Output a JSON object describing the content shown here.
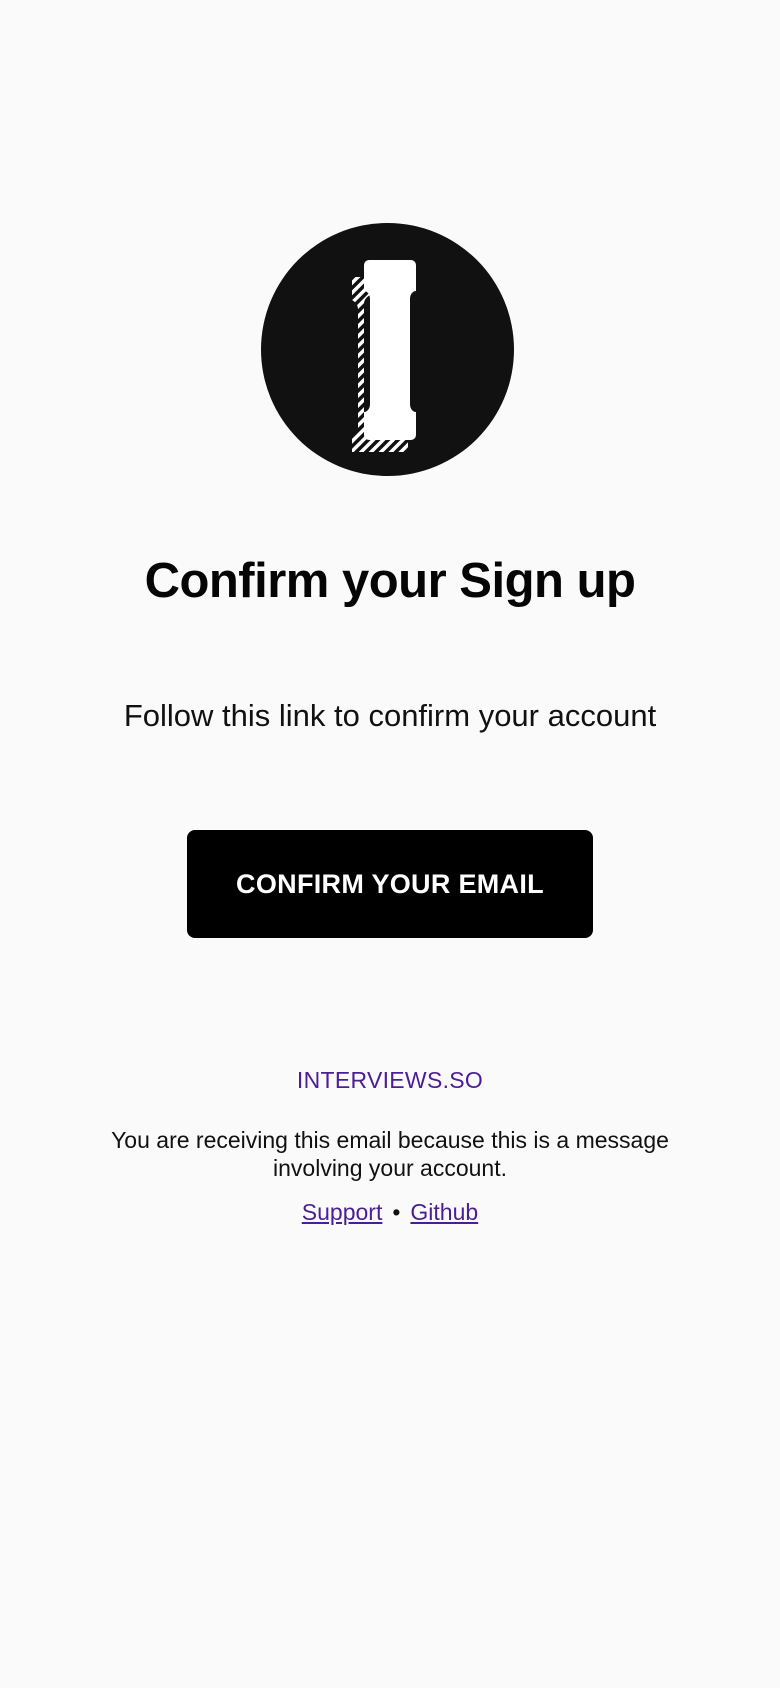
{
  "logo": {
    "icon": "interviews-logo-icon",
    "circle_color": "#111111",
    "glyph_color": "#ffffff"
  },
  "heading": "Confirm your Sign up",
  "subtitle": "Follow this link to confirm your account",
  "button": {
    "label": "CONFIRM YOUR EMAIL",
    "color": "#000000",
    "text_color": "#ffffff"
  },
  "footer": {
    "brand": "INTERVIEWS.SO",
    "brand_color": "#4c1d95",
    "notice": "You are receiving this email because this is a message involving your account.",
    "links": {
      "support": "Support",
      "separator": "•",
      "github": "Github"
    }
  }
}
